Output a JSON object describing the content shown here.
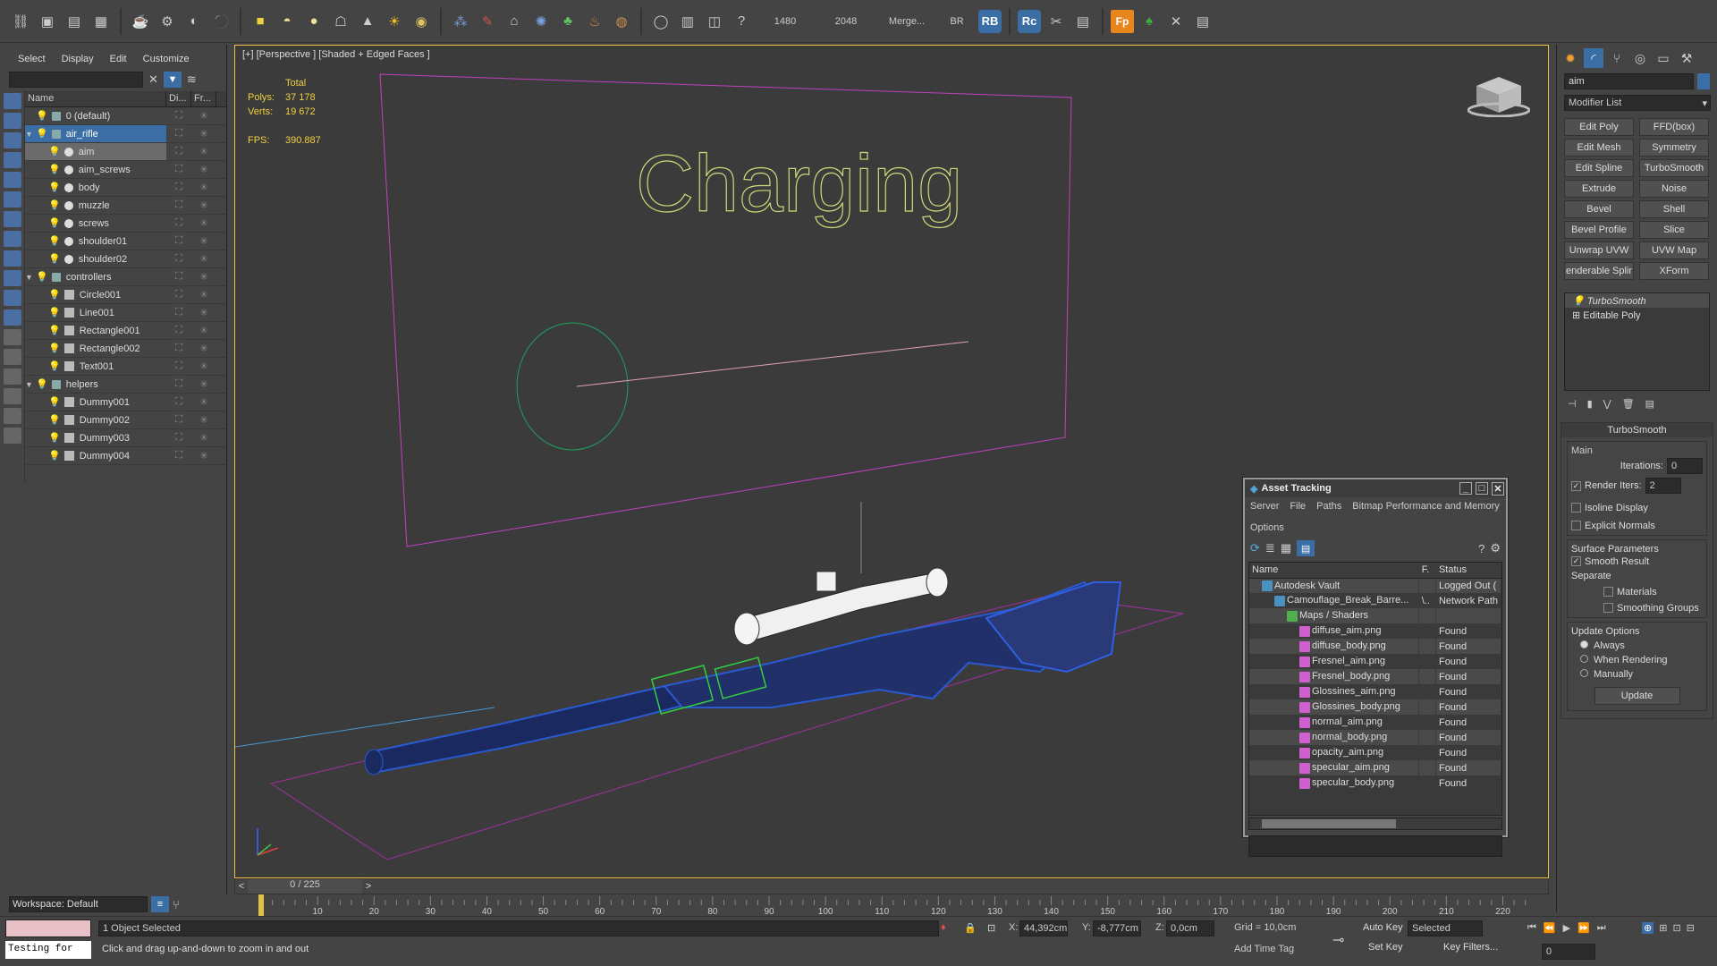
{
  "toolbar": {
    "values": [
      "1480",
      "2048",
      "Merge...",
      "BR"
    ],
    "badges": [
      "RB",
      "Rc",
      "Fp"
    ]
  },
  "scene_explorer": {
    "menu": [
      "Select",
      "Display",
      "Edit",
      "Customize"
    ],
    "columns": [
      "Name",
      "Di...",
      "Fr..."
    ],
    "rows": [
      {
        "label": "0 (default)",
        "kind": "layer",
        "expanded": false,
        "indent": 0
      },
      {
        "label": "air_rifle",
        "kind": "layer",
        "expanded": true,
        "indent": 0,
        "selected": true
      },
      {
        "label": "aim",
        "kind": "object",
        "indent": 1,
        "highlighted": true
      },
      {
        "label": "aim_screws",
        "kind": "object",
        "indent": 1
      },
      {
        "label": "body",
        "kind": "object",
        "indent": 1
      },
      {
        "label": "muzzle",
        "kind": "object",
        "indent": 1
      },
      {
        "label": "screws",
        "kind": "object",
        "indent": 1
      },
      {
        "label": "shoulder01",
        "kind": "object",
        "indent": 1
      },
      {
        "label": "shoulder02",
        "kind": "object",
        "indent": 1
      },
      {
        "label": "controllers",
        "kind": "layer",
        "expanded": true,
        "indent": 0
      },
      {
        "label": "Circle001",
        "kind": "shape",
        "indent": 1
      },
      {
        "label": "Line001",
        "kind": "shape",
        "indent": 1
      },
      {
        "label": "Rectangle001",
        "kind": "shape",
        "indent": 1
      },
      {
        "label": "Rectangle002",
        "kind": "shape",
        "indent": 1
      },
      {
        "label": "Text001",
        "kind": "shape",
        "indent": 1
      },
      {
        "label": "helpers",
        "kind": "layer",
        "expanded": true,
        "indent": 0
      },
      {
        "label": "Dummy001",
        "kind": "helper",
        "indent": 1
      },
      {
        "label": "Dummy002",
        "kind": "helper",
        "indent": 1
      },
      {
        "label": "Dummy003",
        "kind": "helper",
        "indent": 1
      },
      {
        "label": "Dummy004",
        "kind": "helper",
        "indent": 1
      }
    ],
    "workspace": "Workspace: Default"
  },
  "viewport": {
    "label": "[+] [Perspective ] [Shaded + Edged Faces ]",
    "stats": {
      "total_label": "Total",
      "polys_label": "Polys:",
      "polys_value": "37 178",
      "verts_label": "Verts:",
      "verts_value": "19 672",
      "fps_label": "FPS:",
      "fps_value": "390.887"
    },
    "scene_text": "Charging"
  },
  "timeline": {
    "frame": "0 / 225",
    "ticks": [
      "10",
      "20",
      "30",
      "40",
      "50",
      "60",
      "70",
      "80",
      "90",
      "100",
      "110",
      "120",
      "130",
      "140",
      "150",
      "160",
      "170",
      "180",
      "190",
      "200",
      "210",
      "220"
    ]
  },
  "status": {
    "selection": "1 Object Selected",
    "prompt": "Click and drag up-and-down to zoom in and out",
    "x_label": "X:",
    "x_value": "44,392cm",
    "y_label": "Y:",
    "y_value": "-8,777cm",
    "z_label": "Z:",
    "z_value": "0,0cm",
    "grid": "Grid = 10,0cm",
    "add_time_tag": "Add Time Tag",
    "auto_key": "Auto Key",
    "set_key": "Set Key",
    "key_mode": "Selected",
    "key_filters": "Key Filters...",
    "frame_value": "0",
    "maxscript": "Testing for"
  },
  "command_panel": {
    "object_name": "aim",
    "modifier_list": "Modifier List",
    "modifier_buttons": [
      [
        "Edit Poly",
        "FFD(box)"
      ],
      [
        "Edit Mesh",
        "Symmetry"
      ],
      [
        "Edit Spline",
        "TurboSmooth"
      ],
      [
        "Extrude",
        "Noise"
      ],
      [
        "Bevel",
        "Shell"
      ],
      [
        "Bevel Profile",
        "Slice"
      ],
      [
        "Unwrap UVW",
        "UVW Map"
      ],
      [
        "enderable Splir",
        "XForm"
      ]
    ],
    "stack": [
      "TurboSmooth",
      "Editable Poly"
    ],
    "rollout": {
      "title": "TurboSmooth",
      "main": "Main",
      "iterations_label": "Iterations:",
      "iterations_value": "0",
      "render_iters_label": "Render Iters:",
      "render_iters_value": "2",
      "isoline": "Isoline Display",
      "explicit": "Explicit Normals",
      "surface": "Surface Parameters",
      "smooth_result": "Smooth Result",
      "separate": "Separate",
      "materials": "Materials",
      "smoothing_groups": "Smoothing Groups",
      "update_options": "Update Options",
      "always": "Always",
      "when_rendering": "When Rendering",
      "manually": "Manually",
      "update": "Update"
    }
  },
  "asset_tracking": {
    "title": "Asset Tracking",
    "menu": [
      "Server",
      "File",
      "Paths",
      "Bitmap Performance and Memory",
      "Options"
    ],
    "columns": [
      "Name",
      "F.",
      "Status"
    ],
    "rows": [
      {
        "name": "Autodesk Vault",
        "f": "",
        "status": "Logged Out (",
        "level": 1,
        "icon": "vault"
      },
      {
        "name": "Camouflage_Break_Barre...",
        "f": "\\..",
        "status": "Network Path",
        "level": 2,
        "icon": "max"
      },
      {
        "name": "Maps / Shaders",
        "f": "",
        "status": "",
        "level": 3,
        "icon": "maps"
      },
      {
        "name": "diffuse_aim.png",
        "f": "",
        "status": "Found",
        "level": 4,
        "icon": "png"
      },
      {
        "name": "diffuse_body.png",
        "f": "",
        "status": "Found",
        "level": 4,
        "icon": "png"
      },
      {
        "name": "Fresnel_aim.png",
        "f": "",
        "status": "Found",
        "level": 4,
        "icon": "png"
      },
      {
        "name": "Fresnel_body.png",
        "f": "",
        "status": "Found",
        "level": 4,
        "icon": "png"
      },
      {
        "name": "Glossines_aim.png",
        "f": "",
        "status": "Found",
        "level": 4,
        "icon": "png"
      },
      {
        "name": "Glossines_body.png",
        "f": "",
        "status": "Found",
        "level": 4,
        "icon": "png"
      },
      {
        "name": "normal_aim.png",
        "f": "",
        "status": "Found",
        "level": 4,
        "icon": "png"
      },
      {
        "name": "normal_body.png",
        "f": "",
        "status": "Found",
        "level": 4,
        "icon": "png"
      },
      {
        "name": "opacity_aim.png",
        "f": "",
        "status": "Found",
        "level": 4,
        "icon": "png"
      },
      {
        "name": "specular_aim.png",
        "f": "",
        "status": "Found",
        "level": 4,
        "icon": "png"
      },
      {
        "name": "specular_body.png",
        "f": "",
        "status": "Found",
        "level": 4,
        "icon": "png"
      }
    ]
  },
  "colors": {
    "accent": "#3a6ea5",
    "viewport_border": "#f0c040",
    "stats": "#f0d040",
    "text_shape": "#d0d878",
    "rectangle": "#c040c0",
    "circle": "#20a060"
  }
}
